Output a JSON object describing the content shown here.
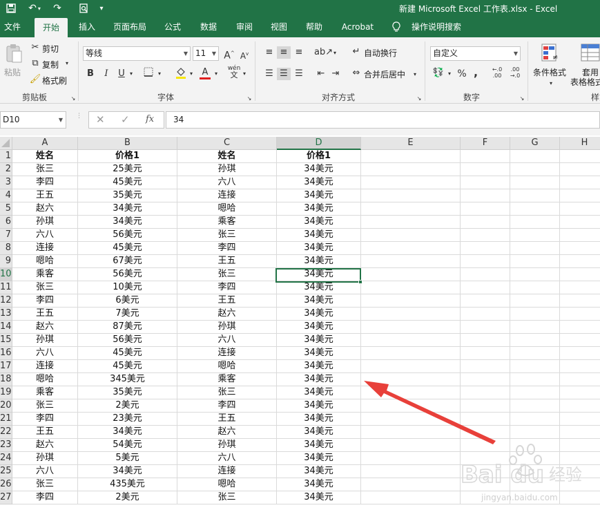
{
  "window": {
    "title": "新建 Microsoft Excel 工作表.xlsx  -  Excel"
  },
  "menu_tabs": [
    "文件",
    "开始",
    "插入",
    "页面布局",
    "公式",
    "数据",
    "审阅",
    "视图",
    "帮助",
    "Acrobat",
    "操作说明搜索"
  ],
  "active_tab": "开始",
  "ribbon": {
    "clipboard": {
      "group": "剪贴板",
      "paste": "粘贴",
      "cut": "剪切",
      "copy": "复制",
      "format_painter": "格式刷"
    },
    "font": {
      "group": "字体",
      "font_name": "等线",
      "font_size": "11",
      "bold": "B",
      "italic": "I",
      "underline": "U",
      "font_color": "A",
      "phonetic": "wén"
    },
    "alignment": {
      "group": "对齐方式",
      "wrap": "自动换行",
      "merge": "合并后居中"
    },
    "number": {
      "group": "数字",
      "format": "自定义",
      "percent": "%",
      "comma": ",",
      "inc_decimal": "←.0 .00",
      "dec_decimal": ".00 →.0"
    },
    "styles": {
      "group": "样式",
      "conditional": "条件格式",
      "table_line1": "套用",
      "table_line2": "表格格式"
    }
  },
  "formula_bar": {
    "name_box": "D10",
    "fx": "fx",
    "value": "34"
  },
  "columns": [
    "A",
    "B",
    "C",
    "D",
    "E",
    "F",
    "G",
    "H"
  ],
  "selected_column": "D",
  "selected_row": "10",
  "row_labels": [
    "1",
    "2",
    "3",
    "4",
    "5",
    "6",
    "7",
    "8",
    "9",
    "10",
    "11",
    "12",
    "13",
    "14",
    "15",
    "16",
    "17",
    "18",
    "19",
    "20",
    "21",
    "22",
    "23",
    "24",
    "25",
    "26",
    "27"
  ],
  "rows": [
    [
      "姓名",
      "价格1",
      "姓名",
      "价格1"
    ],
    [
      "张三",
      "25美元",
      "孙琪",
      "34美元"
    ],
    [
      "李四",
      "45美元",
      "六八",
      "34美元"
    ],
    [
      "王五",
      "35美元",
      "连接",
      "34美元"
    ],
    [
      "赵六",
      "34美元",
      "嗯哈",
      "34美元"
    ],
    [
      "孙琪",
      "34美元",
      "乘客",
      "34美元"
    ],
    [
      "六八",
      "56美元",
      "张三",
      "34美元"
    ],
    [
      "连接",
      "45美元",
      "李四",
      "34美元"
    ],
    [
      "嗯哈",
      "67美元",
      "王五",
      "34美元"
    ],
    [
      "乘客",
      "56美元",
      "张三",
      "34美元"
    ],
    [
      "张三",
      "10美元",
      "李四",
      "34美元"
    ],
    [
      "李四",
      "6美元",
      "王五",
      "34美元"
    ],
    [
      "王五",
      "7美元",
      "赵六",
      "34美元"
    ],
    [
      "赵六",
      "87美元",
      "孙琪",
      "34美元"
    ],
    [
      "孙琪",
      "56美元",
      "六八",
      "34美元"
    ],
    [
      "六八",
      "45美元",
      "连接",
      "34美元"
    ],
    [
      "连接",
      "45美元",
      "嗯哈",
      "34美元"
    ],
    [
      "嗯哈",
      "345美元",
      "乘客",
      "34美元"
    ],
    [
      "乘客",
      "35美元",
      "张三",
      "34美元"
    ],
    [
      "张三",
      "2美元",
      "李四",
      "34美元"
    ],
    [
      "李四",
      "23美元",
      "王五",
      "34美元"
    ],
    [
      "王五",
      "34美元",
      "赵六",
      "34美元"
    ],
    [
      "赵六",
      "54美元",
      "孙琪",
      "34美元"
    ],
    [
      "孙琪",
      "5美元",
      "六八",
      "34美元"
    ],
    [
      "六八",
      "34美元",
      "连接",
      "34美元"
    ],
    [
      "张三",
      "435美元",
      "嗯哈",
      "34美元"
    ],
    [
      "李四",
      "2美元",
      "张三",
      "34美元"
    ]
  ],
  "accent_color": "#217346",
  "annotation_arrow_color": "#e8403a",
  "watermark": {
    "brand": "Bai du 经验",
    "url": "jingyan.baidu.com"
  }
}
